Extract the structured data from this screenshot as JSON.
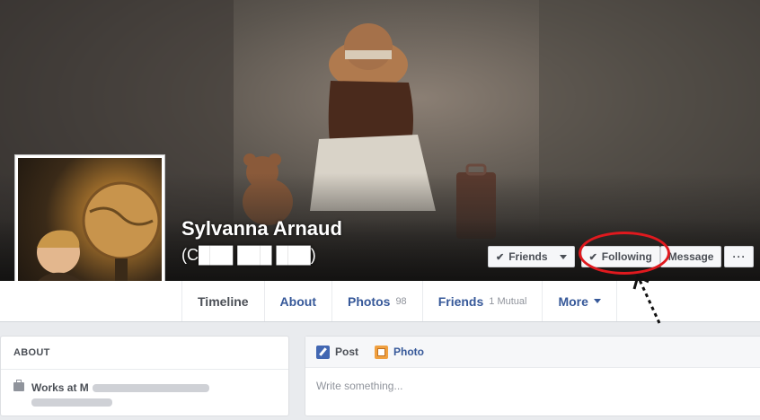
{
  "profile": {
    "name": "Sylvanna Arnaud",
    "alternate_name": "(C███ ███ ███)"
  },
  "actions": {
    "friends_label": "Friends",
    "following_label": "Following",
    "message_label": "Message",
    "more_label": "···"
  },
  "tabs": [
    {
      "label": "Timeline"
    },
    {
      "label": "About"
    },
    {
      "label": "Photos",
      "count": "98"
    },
    {
      "label": "Friends",
      "count": "1 Mutual"
    },
    {
      "label": "More"
    }
  ],
  "about": {
    "title": "ABOUT",
    "work_prefix": "Works at M"
  },
  "composer": {
    "post_label": "Post",
    "photo_label": "Photo",
    "placeholder": "Write something..."
  },
  "colors": {
    "link": "#365899",
    "annotation": "#e0191e"
  }
}
